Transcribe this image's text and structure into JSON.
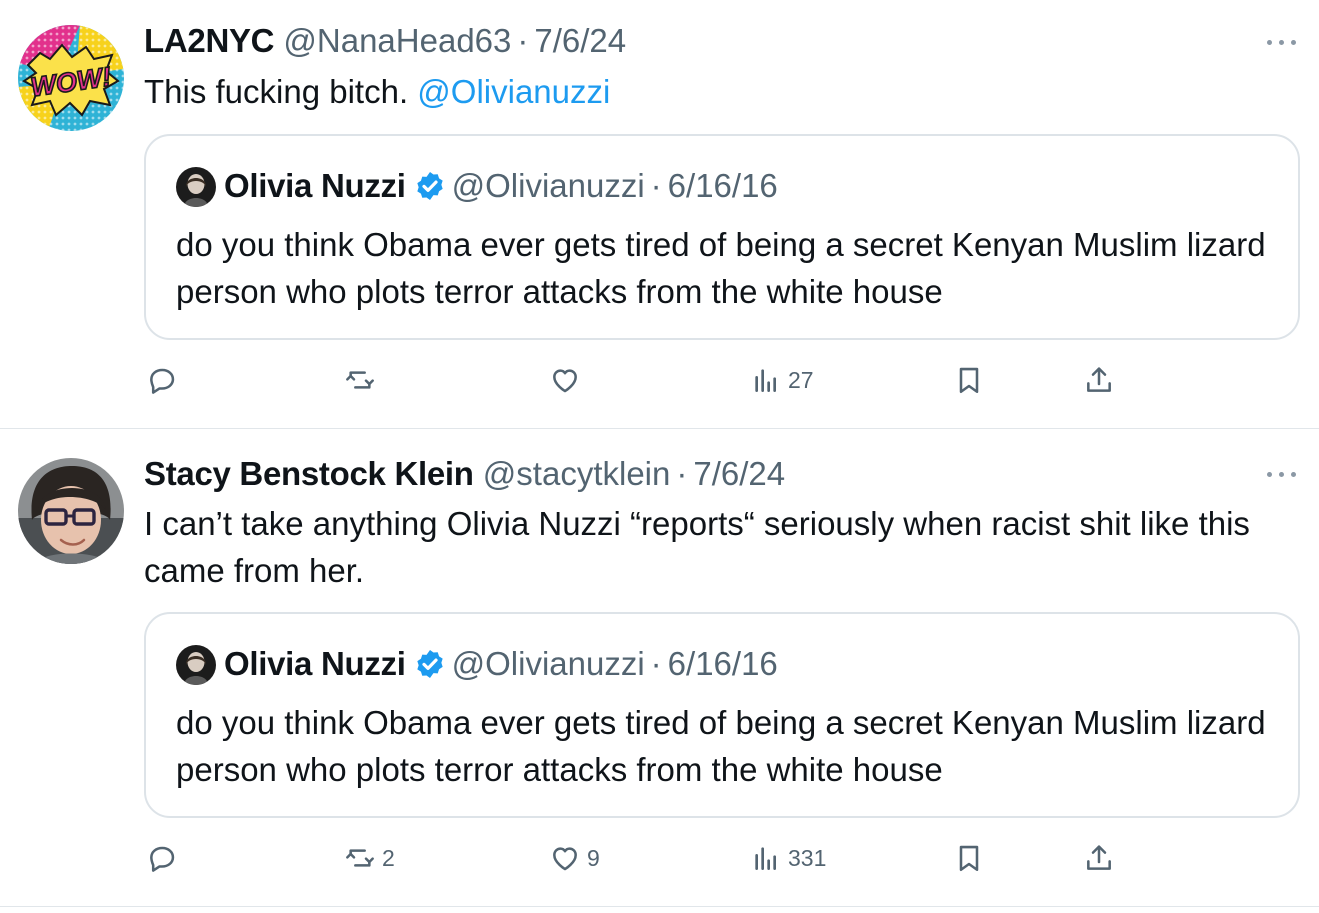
{
  "tweets": [
    {
      "author_name": "LA2NYC",
      "author_handle": "@NanaHead63",
      "separator": "·",
      "date": "7/6/24",
      "text_before_mention": "This fucking bitch. ",
      "text_mention": "@Olivianuzzi",
      "avatar": {
        "icon": "wow-comic-avatar",
        "text": "WOW!"
      },
      "quote": {
        "author_name": "Olivia Nuzzi",
        "author_handle": "@Olivianuzzi",
        "separator": "·",
        "date": "6/16/16",
        "verified_icon": "verified-badge-icon",
        "text": "do you think Obama ever gets tired of being a secret Kenyan Muslim lizard person who plots terror attacks from the white house"
      },
      "actions": {
        "reply": "",
        "retweet": "",
        "like": "",
        "views": "27"
      }
    },
    {
      "author_name": "Stacy Benstock Klein",
      "author_handle": "@stacytklein",
      "separator": "·",
      "date": "7/6/24",
      "text": "I can’t take anything Olivia Nuzzi “reports“ seriously when racist shit like this came from her.",
      "avatar": {
        "icon": "person-with-glasses-avatar"
      },
      "quote": {
        "author_name": "Olivia Nuzzi",
        "author_handle": "@Olivianuzzi",
        "separator": "·",
        "date": "6/16/16",
        "verified_icon": "verified-badge-icon",
        "text": "do you think Obama ever gets tired of being a secret Kenyan Muslim lizard person who plots terror attacks from the white house"
      },
      "actions": {
        "reply": "",
        "retweet": "2",
        "like": "9",
        "views": "331"
      }
    }
  ],
  "colors": {
    "text_primary": "#0f1419",
    "text_secondary": "#536471",
    "link": "#1d9bf0",
    "verified": "#1d9bf0",
    "border": "#e1e6ea"
  }
}
